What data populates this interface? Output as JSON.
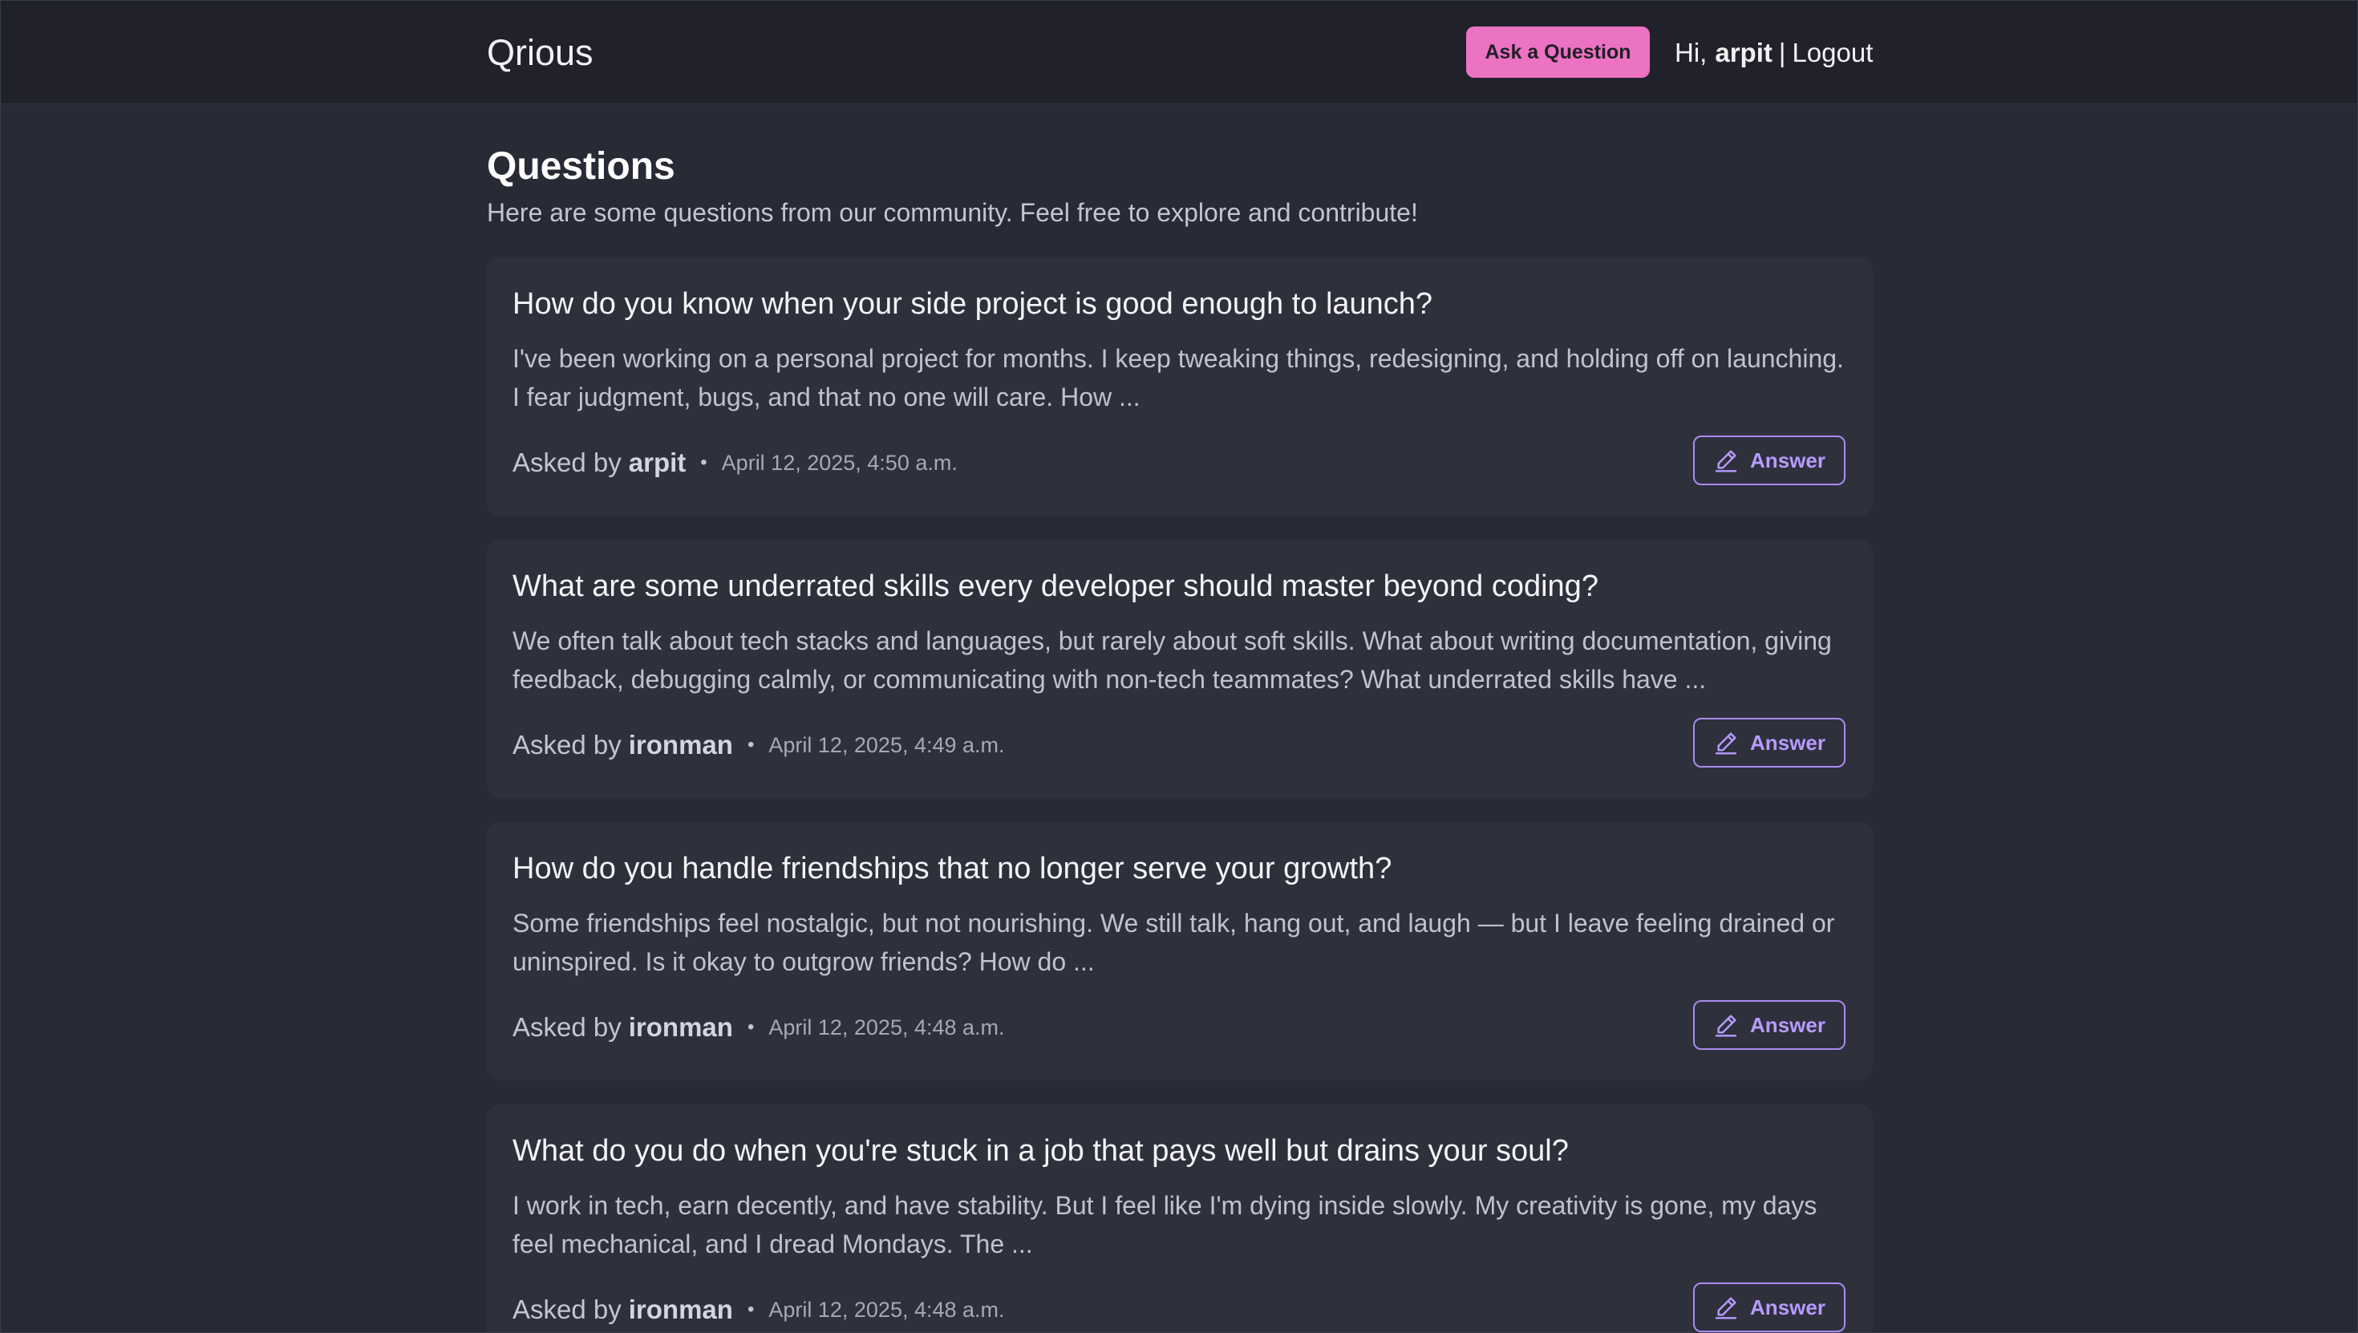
{
  "navbar": {
    "brand": "Qrious",
    "ask_label": "Ask a Question",
    "greeting": "Hi,",
    "username": "arpit",
    "separator": "|",
    "logout_label": "Logout"
  },
  "page": {
    "title": "Questions",
    "subtitle": "Here are some questions from our community. Feel free to explore and contribute!"
  },
  "questions": [
    {
      "title": "How do you know when your side project is good enough to launch?",
      "excerpt": "I've been working on a personal project for months. I keep tweaking things, redesigning, and holding off on launching. I fear judgment, bugs, and that no one will care. How ...",
      "asked_label": "Asked by",
      "author": "arpit",
      "dot": "•",
      "date": "April 12, 2025, 4:50 a.m.",
      "answer_label": "Answer"
    },
    {
      "title": "What are some underrated skills every developer should master beyond coding?",
      "excerpt": "We often talk about tech stacks and languages, but rarely about soft skills. What about writing documentation, giving feedback, debugging calmly, or communicating with non-tech teammates? What underrated skills have ...",
      "asked_label": "Asked by",
      "author": "ironman",
      "dot": "•",
      "date": "April 12, 2025, 4:49 a.m.",
      "answer_label": "Answer"
    },
    {
      "title": "How do you handle friendships that no longer serve your growth?",
      "excerpt": "Some friendships feel nostalgic, but not nourishing. We still talk, hang out, and laugh — but I leave feeling drained or uninspired. Is it okay to outgrow friends? How do ...",
      "asked_label": "Asked by",
      "author": "ironman",
      "dot": "•",
      "date": "April 12, 2025, 4:48 a.m.",
      "answer_label": "Answer"
    },
    {
      "title": "What do you do when you're stuck in a job that pays well but drains your soul?",
      "excerpt": "I work in tech, earn decently, and have stability. But I feel like I'm dying inside slowly. My creativity is gone, my days feel mechanical, and I dread Mondays. The ...",
      "asked_label": "Asked by",
      "author": "ironman",
      "dot": "•",
      "date": "April 12, 2025, 4:48 a.m.",
      "answer_label": "Answer"
    }
  ],
  "icons": {
    "answer": "pencil-icon"
  },
  "colors": {
    "background": "#282a36",
    "navbar": "#20212a",
    "card": "#2e303c",
    "accent_pink": "#ec72c3",
    "accent_purple": "#b89bff"
  }
}
